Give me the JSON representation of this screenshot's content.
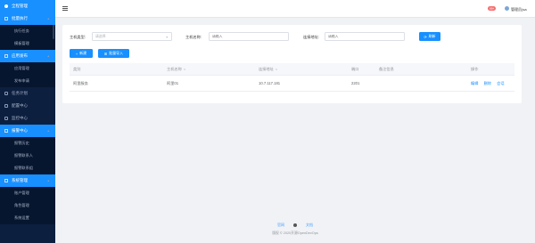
{
  "sidebar": {
    "home": "全程管理",
    "groups": [
      {
        "label": "批量执行",
        "items": [
          "执行任务",
          "模板管理"
        ]
      },
      {
        "label": "应用发布",
        "items": [
          "应用管理",
          "发布申请"
        ]
      }
    ],
    "singles": [
      "任务计划",
      "配置中心",
      "监控中心"
    ],
    "groups2": [
      {
        "label": "报警中心",
        "items": [
          "报警历史",
          "报警联系人",
          "报警联系组"
        ]
      },
      {
        "label": "系统管理",
        "items": [
          "账户管理",
          "角色管理",
          "系统设置"
        ]
      }
    ]
  },
  "topbar": {
    "notice_count": "99+",
    "username": "管理员(sa"
  },
  "search": {
    "type_label": "主机类型:",
    "type_placeholder": "请选择",
    "name_label": "主机名称:",
    "name_placeholder": "请输入",
    "addr_label": "连接地址:",
    "addr_placeholder": "请输入",
    "refresh_label": "刷新"
  },
  "actions": {
    "add_label": "新建",
    "import_label": "批量导入"
  },
  "table": {
    "columns": [
      "类别",
      "主机名称",
      "连接地址",
      "端口",
      "备注信息",
      "操作"
    ],
    "rows": [
      {
        "type": "阿里服务",
        "name": "阿里01",
        "addr": "10.7.117.181",
        "port": "2201",
        "remark": "",
        "ops": [
          "编辑",
          "删除",
          "会话"
        ]
      }
    ]
  },
  "footer": {
    "link1": "官网",
    "link2": "文档",
    "copyright": "版权 © 2020开源OpenDevOps"
  }
}
